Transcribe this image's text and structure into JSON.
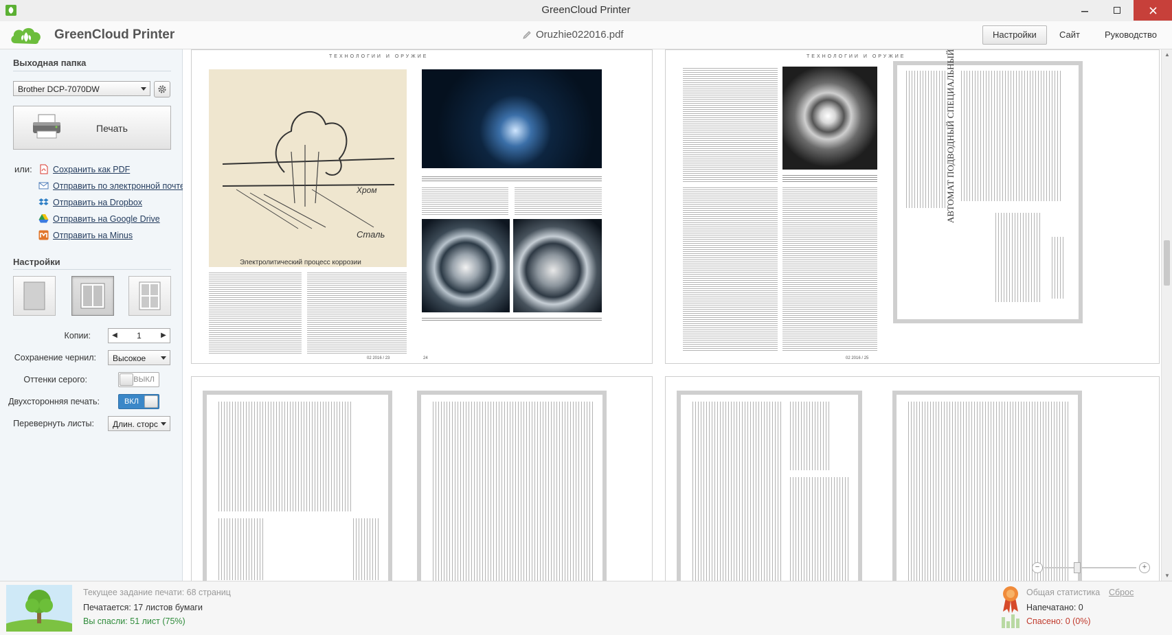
{
  "window": {
    "title": "GreenCloud Printer"
  },
  "header": {
    "brand": "GreenCloud Printer",
    "file_name": "Oruzhie022016.pdf",
    "nav": {
      "settings": "Настройки",
      "site": "Сайт",
      "guide": "Руководство"
    }
  },
  "sidebar": {
    "output_title": "Выходная папка",
    "printer_select": "Brother DCP-7070DW",
    "print_button": "Печать",
    "or_label": "или:",
    "links": [
      {
        "label": "Сохранить как PDF",
        "icon": "pdf-icon",
        "color": "#d9362c"
      },
      {
        "label": "Отправить по электронной почте",
        "icon": "email-icon",
        "color": "#4a79b8"
      },
      {
        "label": "Отправить на Dropbox",
        "icon": "dropbox-icon",
        "color": "#2f7fc6"
      },
      {
        "label": "Отправить на Google Drive",
        "icon": "google-drive-icon",
        "color": "#2f9b4a"
      },
      {
        "label": "Отправить на Minus",
        "icon": "minus-icon",
        "color": "#e1762b"
      }
    ],
    "settings_title": "Настройки",
    "layouts": [
      "one-page-layout",
      "two-page-layout",
      "four-page-layout"
    ],
    "selected_layout": "two-page-layout",
    "copies_label": "Копии:",
    "copies_value": "1",
    "ink_label": "Сохранение чернил:",
    "ink_value": "Высокое",
    "grayscale_label": "Оттенки серого:",
    "grayscale_value": "ВЫКЛ",
    "duplex_label": "Двухсторонняя печать:",
    "duplex_value": "ВКЛ",
    "flip_label": "Перевернуть листы:",
    "flip_value": "Длин. сторс"
  },
  "preview": {
    "magazine_header": "ТЕХНОЛОГИИ И ОРУЖИЕ",
    "figure_caption": "Электролитический процесс коррозии",
    "figure_words": [
      "Хром",
      "Сталь"
    ],
    "page_numbers": [
      "02 2016 / 23",
      "24",
      "02 2016 / 25"
    ],
    "scan_pages_count": 8,
    "manual_title": "АВТОМАТ ПОДВОДНЫЙ СПЕЦИАЛЬНЫЙ (АПС)",
    "zoom": {
      "level": 0.35
    }
  },
  "status": {
    "current_job": "Текущее задание печати: 68 страниц",
    "printing": "Печатается: 17 листов бумаги",
    "saved": "Вы спасли: 51 лист (75%)",
    "stats_title": "Общая статистика",
    "reset": "Сброс",
    "printed": "Напечатано: 0",
    "rescued": "Спасено: 0 (0%)"
  },
  "colors": {
    "accent_blue": "#3a87c8",
    "saved_green": "#2e8b3a",
    "rescued_red": "#c0392b",
    "close_red": "#c7403a"
  }
}
